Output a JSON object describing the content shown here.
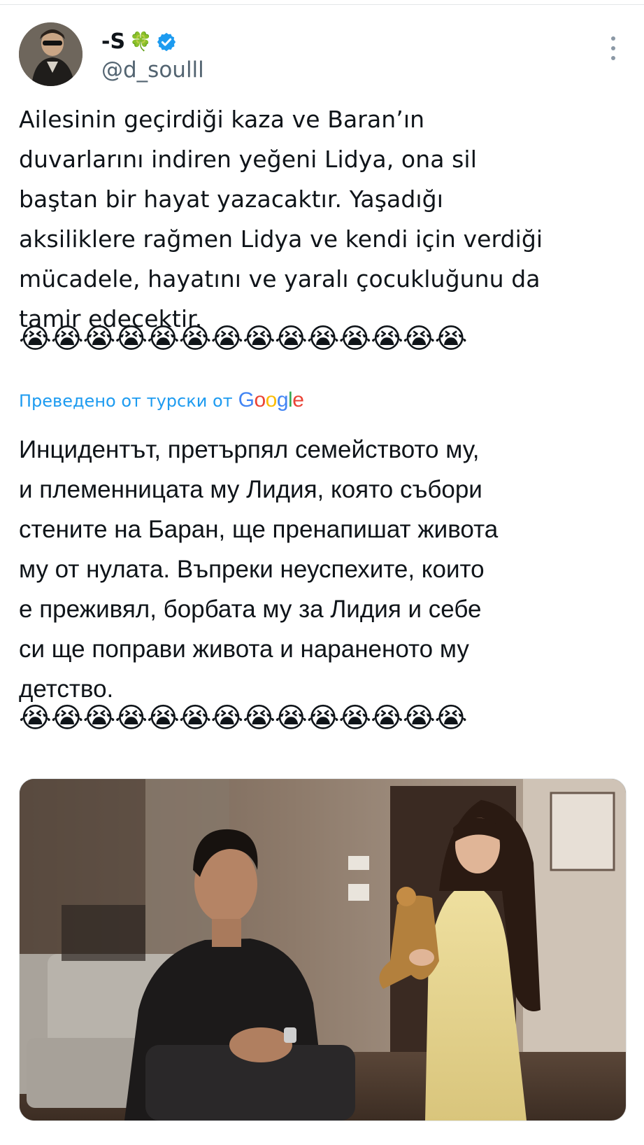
{
  "author": {
    "display_name": "-S",
    "clover": "🍀",
    "handle": "@d_soulll",
    "verified_color": "#1d9bf0"
  },
  "tweet": {
    "original_text": "Ailesinin geçirdiği kaza ve Baran’ın\nduvarlarını indiren yeğeni Lidya, ona sil\nbaştan bir hayat yazacaktır. Yaşadığı\naksiliklere rağmen Lidya ve kendi için verdiği\nmücadele, hayatını ve yaralı çocukluğunu da\ntamir edecektir.",
    "emojis": "😭😭😭😭😭😭😭😭😭😭😭😭😭😭",
    "translation_label": "Преведено от турски от",
    "translation_provider": "Google",
    "translated_text": "Инцидентът, претърпял семейството му,\nи племенницата му Лидия, която събори\nстените на Баран, ще пренапишат живота\nму от нулата. Въпреки неуспехите, които\nе преживял, борбата му за Лидия и себе\nси ще поправи живота и нараненото му\nдетство.",
    "translated_emojis": "😭😭😭😭😭😭😭😭😭😭😭😭😭😭"
  },
  "colors": {
    "text": "#0f1419",
    "secondary": "#536471",
    "link_blue": "#1d9bf0"
  },
  "icons": [
    "verified-icon",
    "more-options-icon"
  ]
}
